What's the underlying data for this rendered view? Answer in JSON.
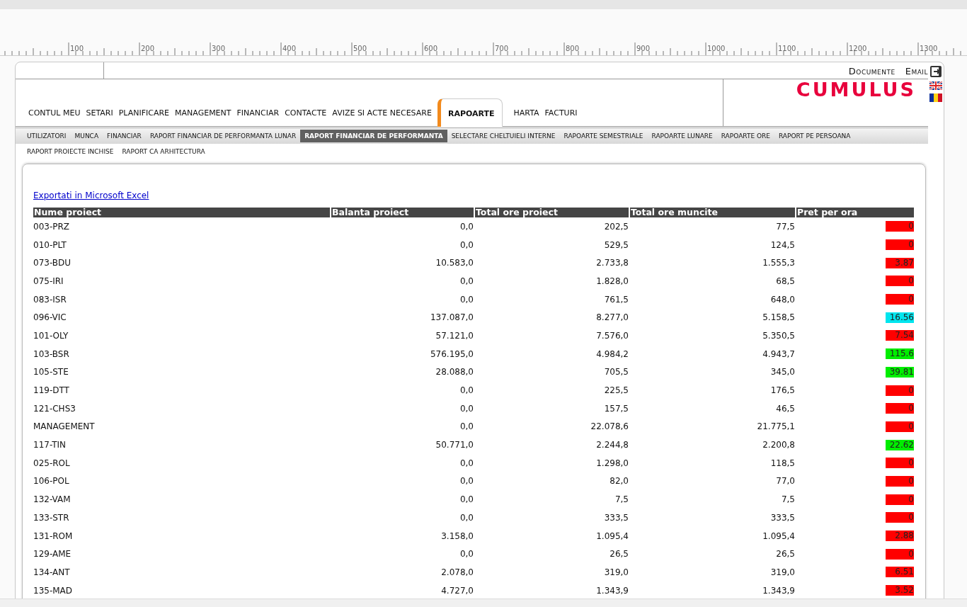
{
  "ruler": {
    "labels": [
      "100",
      "200",
      "300",
      "400",
      "500",
      "600",
      "700",
      "800",
      "900",
      "1000",
      "1100",
      "1200",
      "1300"
    ]
  },
  "header": {
    "links": [
      "Documente",
      "Email"
    ],
    "logo": "CUMULUS"
  },
  "nav": [
    {
      "label": "CONTUL MEU",
      "selected": false
    },
    {
      "label": "SETARI",
      "selected": false
    },
    {
      "label": "PLANIFICARE",
      "selected": false
    },
    {
      "label": "MANAGEMENT",
      "selected": false
    },
    {
      "label": "FINANCIAR",
      "selected": false
    },
    {
      "label": "CONTACTE",
      "selected": false
    },
    {
      "label": "AVIZE SI ACTE NECESARE",
      "selected": false
    },
    {
      "label": "RAPOARTE",
      "selected": true
    },
    {
      "label": "HARTA",
      "selected": false
    },
    {
      "label": "FACTURI",
      "selected": false
    }
  ],
  "subnav": [
    {
      "label": "UTILIZATORI",
      "selected": false
    },
    {
      "label": "MUNCA",
      "selected": false
    },
    {
      "label": "FINANCIAR",
      "selected": false
    },
    {
      "label": "RAPORT FINANCIAR DE PERFORMANTA LUNAR",
      "selected": false
    },
    {
      "label": "RAPORT FINANCIAR DE PERFORMANTA",
      "selected": true
    },
    {
      "label": "SELECTARE CHELTUIELI INTERNE",
      "selected": false
    },
    {
      "label": "RAPOARTE SEMESTRIALE",
      "selected": false
    },
    {
      "label": "RAPOARTE LUNARE",
      "selected": false
    },
    {
      "label": "RAPOARTE ORE",
      "selected": false
    },
    {
      "label": "RAPORT PE PERSOANA",
      "selected": false
    },
    {
      "label": "RAPORT PROIECTE INCHISE",
      "selected": false
    },
    {
      "label": "RAPORT CA ARHITECTURA",
      "selected": false
    }
  ],
  "export_link": "Exportati in Microsoft Excel",
  "table": {
    "columns": [
      "Nume proiect",
      "Balanta proiect",
      "Total ore proiect",
      "Total ore muncite",
      "Pret per ora"
    ],
    "rows": [
      {
        "name": "003-PRZ",
        "balance": "0,0",
        "total_hours": "202,5",
        "worked_hours": "77,5",
        "price": "0",
        "color": "#ff0000"
      },
      {
        "name": "010-PLT",
        "balance": "0,0",
        "total_hours": "529,5",
        "worked_hours": "124,5",
        "price": "0",
        "color": "#ff0000"
      },
      {
        "name": "073-BDU",
        "balance": "10.583,0",
        "total_hours": "2.733,8",
        "worked_hours": "1.555,3",
        "price": "3.87",
        "color": "#ff0000"
      },
      {
        "name": "075-IRI",
        "balance": "0,0",
        "total_hours": "1.828,0",
        "worked_hours": "68,5",
        "price": "0",
        "color": "#ff0000"
      },
      {
        "name": "083-ISR",
        "balance": "0,0",
        "total_hours": "761,5",
        "worked_hours": "648,0",
        "price": "0",
        "color": "#ff0000"
      },
      {
        "name": "096-VIC",
        "balance": "137.087,0",
        "total_hours": "8.277,0",
        "worked_hours": "5.158,5",
        "price": "16.56",
        "color": "#00e5ee"
      },
      {
        "name": "101-OLY",
        "balance": "57.121,0",
        "total_hours": "7.576,0",
        "worked_hours": "5.350,5",
        "price": "7.54",
        "color": "#ff0000"
      },
      {
        "name": "103-BSR",
        "balance": "576.195,0",
        "total_hours": "4.984,2",
        "worked_hours": "4.943,7",
        "price": "115.6",
        "color": "#00ee00"
      },
      {
        "name": "105-STE",
        "balance": "28.088,0",
        "total_hours": "705,5",
        "worked_hours": "345,0",
        "price": "39.81",
        "color": "#00ee00"
      },
      {
        "name": "119-DTT",
        "balance": "0,0",
        "total_hours": "225,5",
        "worked_hours": "176,5",
        "price": "0",
        "color": "#ff0000"
      },
      {
        "name": "121-CHS3",
        "balance": "0,0",
        "total_hours": "157,5",
        "worked_hours": "46,5",
        "price": "0",
        "color": "#ff0000"
      },
      {
        "name": "MANAGEMENT",
        "balance": "0,0",
        "total_hours": "22.078,6",
        "worked_hours": "21.775,1",
        "price": "0",
        "color": "#ff0000"
      },
      {
        "name": "117-TIN",
        "balance": "50.771,0",
        "total_hours": "2.244,8",
        "worked_hours": "2.200,8",
        "price": "22.62",
        "color": "#00ee00"
      },
      {
        "name": "025-ROL",
        "balance": "0,0",
        "total_hours": "1.298,0",
        "worked_hours": "118,5",
        "price": "0",
        "color": "#ff0000"
      },
      {
        "name": "106-POL",
        "balance": "0,0",
        "total_hours": "82,0",
        "worked_hours": "77,0",
        "price": "0",
        "color": "#ff0000"
      },
      {
        "name": "132-VAM",
        "balance": "0,0",
        "total_hours": "7,5",
        "worked_hours": "7,5",
        "price": "0",
        "color": "#ff0000"
      },
      {
        "name": "133-STR",
        "balance": "0,0",
        "total_hours": "333,5",
        "worked_hours": "333,5",
        "price": "0",
        "color": "#ff0000"
      },
      {
        "name": "131-ROM",
        "balance": "3.158,0",
        "total_hours": "1.095,4",
        "worked_hours": "1.095,4",
        "price": "2.88",
        "color": "#ff0000"
      },
      {
        "name": "129-AME",
        "balance": "0,0",
        "total_hours": "26,5",
        "worked_hours": "26,5",
        "price": "0",
        "color": "#ff0000"
      },
      {
        "name": "134-ANT",
        "balance": "2.078,0",
        "total_hours": "319,0",
        "worked_hours": "319,0",
        "price": "6.51",
        "color": "#ff0000"
      },
      {
        "name": "135-MAD",
        "balance": "4.727,0",
        "total_hours": "1.343,9",
        "worked_hours": "1.343,9",
        "price": "3.52",
        "color": "#ff0000"
      }
    ]
  }
}
